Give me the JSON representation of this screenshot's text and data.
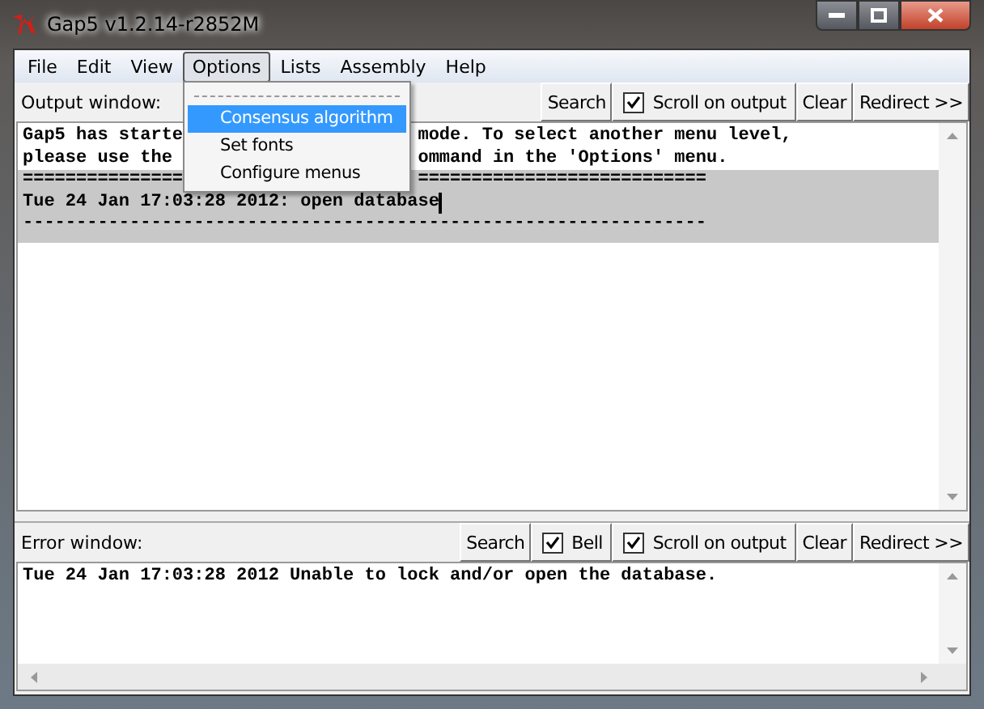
{
  "window": {
    "title": "Gap5 v1.2.14-r2852M"
  },
  "menu_bar": [
    {
      "label": "File",
      "selected": false
    },
    {
      "label": "Edit",
      "selected": false
    },
    {
      "label": "View",
      "selected": false
    },
    {
      "label": "Options",
      "selected": true
    },
    {
      "label": "Lists",
      "selected": false
    },
    {
      "label": "Assembly",
      "selected": false
    },
    {
      "label": "Help",
      "selected": false
    }
  ],
  "options_menu": [
    {
      "label": "Consensus algorithm",
      "selected": true
    },
    {
      "label": "Set fonts",
      "selected": false
    },
    {
      "label": "Configure menus",
      "selected": false
    }
  ],
  "output_panel": {
    "label": "Output window:",
    "controls": [
      {
        "kind": "button",
        "label": "Search"
      },
      {
        "kind": "checkbox",
        "label": "Scroll on output",
        "checked": true
      },
      {
        "kind": "button",
        "label": "Clear"
      },
      {
        "kind": "button",
        "label": "Redirect >>"
      }
    ],
    "lines": [
      {
        "left": "Gap5 has starte",
        "right": "mode. To select another menu level,",
        "highlighted": false
      },
      {
        "left": "please use the",
        "right": "ommand in the 'Options' menu.",
        "highlighted": false
      },
      {
        "left": "===============",
        "right": "===========================",
        "highlighted": true
      },
      {
        "left": "Tue 24 Jan 17:03:28 2012: open database",
        "highlighted": true,
        "cursor": true
      },
      {
        "left": "----------------------------------------------------------------",
        "highlighted": true
      }
    ]
  },
  "error_panel": {
    "label": "Error window:",
    "controls": [
      {
        "kind": "button",
        "label": "Search"
      },
      {
        "kind": "checkbox",
        "label": "Bell",
        "checked": true
      },
      {
        "kind": "checkbox",
        "label": "Scroll on output",
        "checked": true
      },
      {
        "kind": "button",
        "label": "Clear"
      },
      {
        "kind": "button",
        "label": "Redirect >>"
      }
    ],
    "lines": [
      {
        "left": "Tue 24 Jan 17:03:28 2012 Unable to lock and/or open the database.",
        "highlighted": false
      }
    ]
  }
}
